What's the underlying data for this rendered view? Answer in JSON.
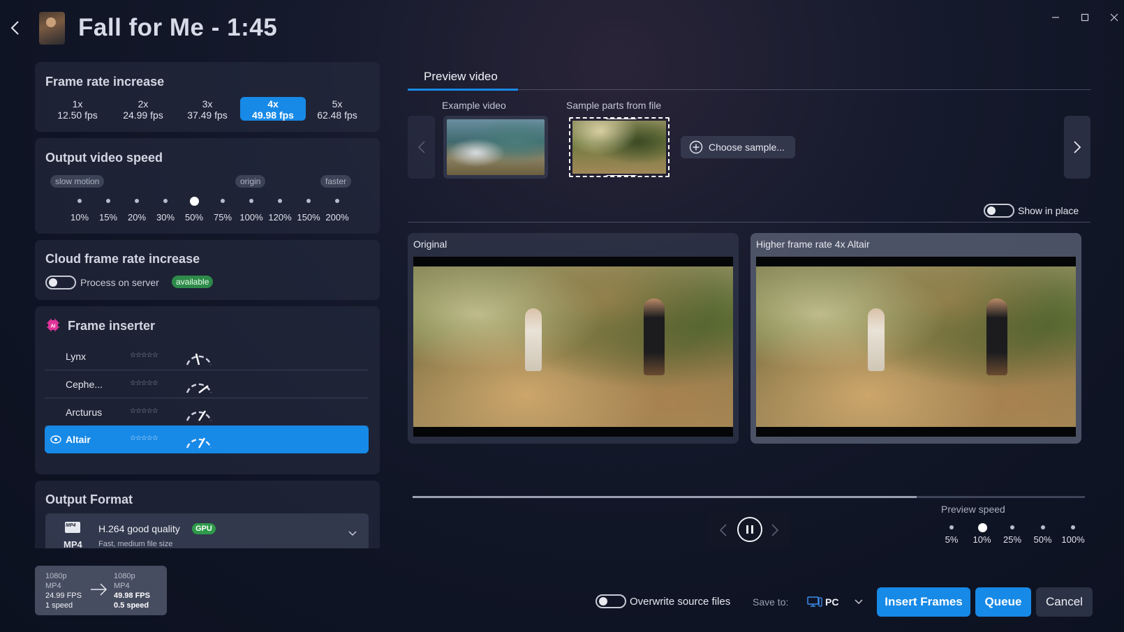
{
  "window": {
    "title": "Fall for Me - 1:45",
    "controls": [
      "minimize-icon",
      "maximize-icon",
      "close-icon"
    ]
  },
  "frame_rate": {
    "title": "Frame rate increase",
    "options": [
      {
        "mult": "1x",
        "fps": "12.50 fps"
      },
      {
        "mult": "2x",
        "fps": "24.99 fps"
      },
      {
        "mult": "3x",
        "fps": "37.49 fps"
      },
      {
        "mult": "4x",
        "fps": "49.98 fps"
      },
      {
        "mult": "5x",
        "fps": "62.48 fps"
      }
    ],
    "selected": "4x"
  },
  "output_speed": {
    "title": "Output video speed",
    "pills": [
      "slow motion",
      "origin",
      "faster"
    ],
    "steps": [
      "10%",
      "15%",
      "20%",
      "30%",
      "50%",
      "75%",
      "100%",
      "120%",
      "150%",
      "200%"
    ],
    "selected": "50%"
  },
  "cloud": {
    "title": "Cloud frame rate increase",
    "toggle_label": "Process on server",
    "badge": "available"
  },
  "frame_inserter": {
    "title": "Frame inserter",
    "models": [
      {
        "name": "Lynx",
        "stars": "☆☆☆☆☆"
      },
      {
        "name": "Cephe...",
        "stars": "☆☆☆☆☆"
      },
      {
        "name": "Arcturus",
        "stars": "☆☆☆☆☆"
      },
      {
        "name": "Altair",
        "stars": "☆☆☆☆☆"
      }
    ],
    "selected": "Altair"
  },
  "output_format": {
    "title": "Output Format",
    "format_name": "H.264 good quality",
    "format_badge": "GPU",
    "format_desc": "Fast, medium file size",
    "container": "MP4"
  },
  "summary": {
    "source": {
      "res": "1080p",
      "container": "MP4",
      "fps": "24.99 FPS",
      "speed": "1 speed"
    },
    "target": {
      "res": "1080p",
      "container": "MP4",
      "fps": "49.98 FPS",
      "speed": "0.5 speed"
    }
  },
  "preview": {
    "tab": "Preview video",
    "example_label": "Example video",
    "sample_label": "Sample parts from file",
    "choose_sample": "Choose sample...",
    "show_in_place": "Show in place",
    "original_label": "Original",
    "processed_label": "Higher frame rate 4x Altair",
    "progress": 0.75,
    "speed_title": "Preview speed",
    "speeds": [
      "5%",
      "10%",
      "25%",
      "50%",
      "100%"
    ],
    "speed_selected": "10%"
  },
  "footer": {
    "overwrite_label": "Overwrite source files",
    "save_to_label": "Save to:",
    "save_to_value": "PC",
    "insert_button": "Insert Frames",
    "queue_button": "Queue",
    "cancel_button": "Cancel"
  },
  "colors": {
    "accent": "#1789e6",
    "available_badge": "#2e8a4a",
    "background": "#121828"
  }
}
